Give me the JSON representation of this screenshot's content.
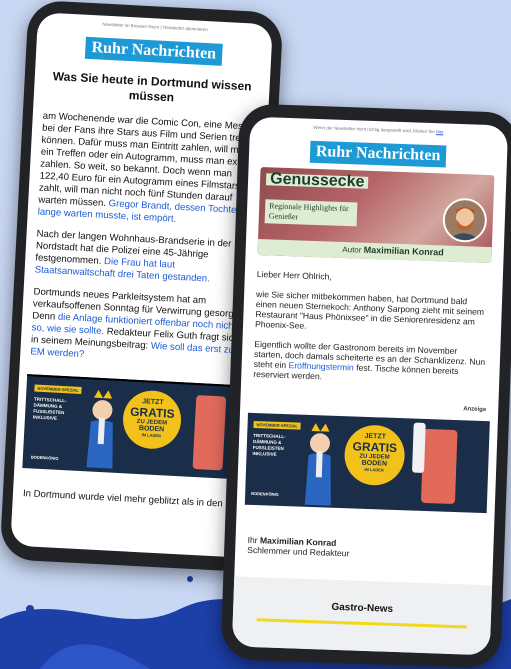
{
  "back_phone": {
    "top_note": "Newsletter im Browser lesen | Newsletter abonnieren",
    "logo": "Ruhr Nachrichten",
    "headline": "Was Sie heute in Dortmund wissen müssen",
    "p1": "am Wochenende war die Comic Con, eine Messe bei der Fans ihre Stars aus Film und Serien treffen können. Dafür muss man Eintritt zahlen, will man ein Treffen oder ein Autogramm, muss man extra zahlen. So weit, so bekannt. Doch wenn man 122,40 Euro für ein Autogramm eines Filmstars zahlt, will man nicht noch fünf Stunden darauf warten müssen.",
    "p1_link": "Gregor Brandt, dessen Tochter so lange warten musste, ist empört.",
    "p2": "Nach der langen Wohnhaus-Brandserie in der Nordstadt hat die Polizei eine 45-Jährige festgenommen.",
    "p2_link": "Die Frau hat laut Staatsanwaltschaft drei Taten gestanden.",
    "p3": "Dortmunds neues Parkleitsystem hat am verkaufsoffenen Sonntag für Verwirrung gesorgt. Denn",
    "p3_link": "die Anlage funktioniert offenbar noch nicht so, wie sie sollte.",
    "p3b": "Redakteur Felix Guth fragt sich in seinem Meinungsbeitrag:",
    "p3b_link": "Wie soll das erst zur EM werden?",
    "p4": "In Dortmund wurde viel mehr geblitzt als in den"
  },
  "front_phone": {
    "top_note": "Wenn der Newsletter nicht richtig dargestellt wird, klicken Sie",
    "top_note_link": "hier",
    "logo": "Ruhr Nachrichten",
    "banner_title": "Genussecke",
    "banner_sub": "Regionale Highlights für Genießer",
    "banner_author_prefix": "Autor",
    "banner_author": "Maximilian Konrad",
    "greeting": "Lieber Herr Ohlrich,",
    "p1": "wie Sie sicher mitbekommen haben, hat Dortmund bald einen neuen Sternekoch: Anthony Sarpong zieht mit seinem Restaurant \"Haus Phönixsee\" in die Seniorenresidenz am Phoenix-See.",
    "p2": "Eigentlich wollte der Gastronom bereits im November starten, doch damals scheiterte es an der Schanklizenz. Nun steht ein",
    "p2_link": "Eröffnungstermin",
    "p2_end": "fest. Tische können bereits reserviert werden.",
    "anzeige": "Anzeige",
    "sign_prefix": "Ihr",
    "sign_name": "Maximilian Konrad",
    "sign_role": "Schlemmer und Redakteur",
    "gastro_label": "Gastro-News"
  },
  "ad": {
    "tag": "NOVEMBER-SPEZIAL",
    "list": [
      "TRITTSCHALL-",
      "DÄMMUNG &",
      "FUSSLEISTEN",
      "INKLUSIVE"
    ],
    "badge_l1": "JETZT",
    "badge_l2": "GRATIS",
    "badge_l3": "ZU JEDEM",
    "badge_l4": "BODEN",
    "badge_l5": "IM LADEN",
    "brand": "BODENKÖNIG"
  },
  "colors": {
    "logo_bg": "#1d9ad6",
    "link": "#1a5bd4",
    "ad_bg": "#1b2e49",
    "ad_accent": "#f2c21a",
    "gastro_bar": "#f0d81c"
  }
}
